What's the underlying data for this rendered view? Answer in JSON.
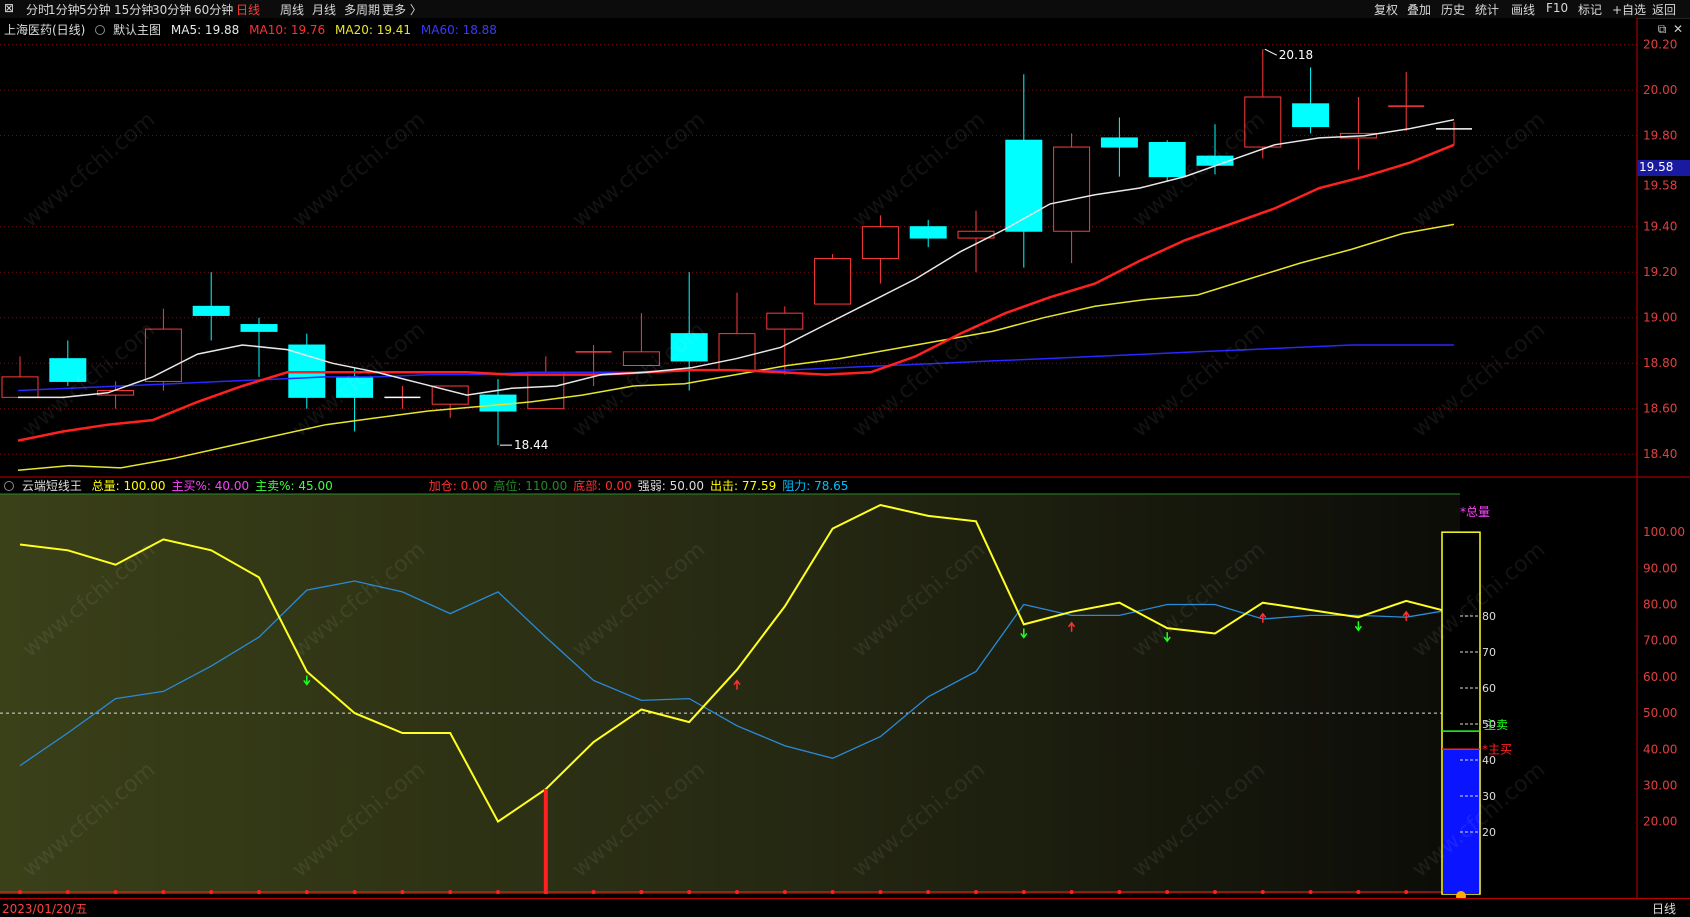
{
  "toolbar": {
    "left_items": [
      "分时",
      "1分钟",
      "5分钟",
      "15分钟",
      "30分钟",
      "60分钟",
      "日线",
      "周线",
      "月线",
      "多周期",
      "更多 〉"
    ],
    "active_item": "日线",
    "right_items": [
      "复权",
      "叠加",
      "历史",
      "统计",
      "画线",
      "F10",
      "标记",
      "+自选",
      "返回"
    ]
  },
  "main_panel": {
    "stock": "上海医药(日线)",
    "chart_name": "默认主图",
    "ma5_label": "MA5: 19.88",
    "ma10_label": "MA10: 19.76",
    "ma20_label": "MA20: 19.41",
    "ma60_label": "MA60: 18.88",
    "high_marker": "20.18",
    "low_marker": "18.44",
    "current_price_tag": "19.58",
    "colors": {
      "ma5": "#e8e8e8",
      "ma10": "#ff2020",
      "ma20": "#e6e62c",
      "ma60": "#2828ff",
      "up": "#ff3b3b",
      "down": "#00ffff"
    }
  },
  "sub_panel": {
    "indicator": "云端短线王",
    "labels": [
      {
        "text": "总量: 100.00",
        "color": "#ffff00"
      },
      {
        "text": "主买%: 40.00",
        "color": "#ff40ff"
      },
      {
        "text": "主卖%: 45.00",
        "color": "#40ff40"
      },
      {
        "text": "加仓: 0.00",
        "color": "#ff3030"
      },
      {
        "text": "高位: 110.00",
        "color": "#228b22"
      },
      {
        "text": "底部: 0.00",
        "color": "#ff3030"
      },
      {
        "text": "强弱: 50.00",
        "color": "#dddddd"
      },
      {
        "text": "出击: 77.59",
        "color": "#ffff00"
      },
      {
        "text": "阻力: 78.65",
        "color": "#00bfff"
      }
    ],
    "gauge_labels": {
      "total": "*总量",
      "sell": "主卖",
      "buy": "*主买"
    },
    "gauge_ticks": [
      "80",
      "70",
      "60",
      "50",
      "40",
      "30",
      "20"
    ]
  },
  "bottom": {
    "date": "2023/01/20/五",
    "period": "日线"
  },
  "watermark": "www.cfchi.com",
  "chart_data": [
    {
      "type": "candlestick",
      "y_ticks": [
        "20.20",
        "20.00",
        "19.80",
        "19.58",
        "19.40",
        "19.20",
        "19.00",
        "18.80",
        "18.60",
        "18.40"
      ],
      "ylim": [
        18.3,
        20.26
      ],
      "candles": [
        {
          "o": 18.65,
          "c": 18.74,
          "h": 18.83,
          "l": 18.65
        },
        {
          "o": 18.82,
          "c": 18.72,
          "h": 18.9,
          "l": 18.7
        },
        {
          "o": 18.66,
          "c": 18.68,
          "h": 18.72,
          "l": 18.6
        },
        {
          "o": 18.72,
          "c": 18.95,
          "h": 19.04,
          "l": 18.68
        },
        {
          "o": 19.05,
          "c": 19.01,
          "h": 19.2,
          "l": 18.9
        },
        {
          "o": 18.97,
          "c": 18.94,
          "h": 19.0,
          "l": 18.74
        },
        {
          "o": 18.88,
          "c": 18.65,
          "h": 18.93,
          "l": 18.6
        },
        {
          "o": 18.74,
          "c": 18.65,
          "h": 18.78,
          "l": 18.5
        },
        {
          "o": 18.65,
          "c": 18.65,
          "h": 18.7,
          "l": 18.6
        },
        {
          "o": 18.62,
          "c": 18.7,
          "h": 18.7,
          "l": 18.56
        },
        {
          "o": 18.66,
          "c": 18.59,
          "h": 18.73,
          "l": 18.44
        },
        {
          "o": 18.6,
          "c": 18.76,
          "h": 18.83,
          "l": 18.6
        },
        {
          "o": 18.85,
          "c": 18.85,
          "h": 18.88,
          "l": 18.7
        },
        {
          "o": 18.79,
          "c": 18.85,
          "h": 19.02,
          "l": 18.79
        },
        {
          "o": 18.93,
          "c": 18.81,
          "h": 19.2,
          "l": 18.68
        },
        {
          "o": 18.77,
          "c": 18.93,
          "h": 19.11,
          "l": 18.77
        },
        {
          "o": 18.95,
          "c": 19.02,
          "h": 19.05,
          "l": 18.75
        },
        {
          "o": 19.06,
          "c": 19.26,
          "h": 19.28,
          "l": 19.06
        },
        {
          "o": 19.26,
          "c": 19.4,
          "h": 19.45,
          "l": 19.15
        },
        {
          "o": 19.4,
          "c": 19.35,
          "h": 19.43,
          "l": 19.31
        },
        {
          "o": 19.35,
          "c": 19.38,
          "h": 19.47,
          "l": 19.2
        },
        {
          "o": 19.78,
          "c": 19.38,
          "h": 20.07,
          "l": 19.22
        },
        {
          "o": 19.38,
          "c": 19.75,
          "h": 19.81,
          "l": 19.24
        },
        {
          "o": 19.79,
          "c": 19.75,
          "h": 19.88,
          "l": 19.62
        },
        {
          "o": 19.77,
          "c": 19.62,
          "h": 19.78,
          "l": 19.6
        },
        {
          "o": 19.71,
          "c": 19.67,
          "h": 19.85,
          "l": 19.63
        },
        {
          "o": 19.75,
          "c": 19.97,
          "h": 20.18,
          "l": 19.7
        },
        {
          "o": 19.94,
          "c": 19.84,
          "h": 20.1,
          "l": 19.81
        },
        {
          "o": 19.79,
          "c": 19.81,
          "h": 19.97,
          "l": 19.65
        },
        {
          "o": 19.93,
          "c": 19.93,
          "h": 20.08,
          "l": 19.82
        },
        {
          "o": 19.83,
          "c": 19.83,
          "h": 19.86,
          "l": 19.76
        }
      ],
      "ma5": [
        18.65,
        18.65,
        18.67,
        18.74,
        18.84,
        18.88,
        18.86,
        18.8,
        18.76,
        18.71,
        18.66,
        18.69,
        18.7,
        18.75,
        18.76,
        18.78,
        18.82,
        18.87,
        18.97,
        19.07,
        19.17,
        19.29,
        19.39,
        19.5,
        19.54,
        19.57,
        19.62,
        19.69,
        19.76,
        19.79,
        19.8,
        19.83,
        19.87
      ],
      "ma10": [
        18.46,
        18.5,
        18.53,
        18.55,
        18.63,
        18.7,
        18.76,
        18.76,
        18.76,
        18.76,
        18.76,
        18.75,
        18.75,
        18.75,
        18.76,
        18.77,
        18.77,
        18.76,
        18.75,
        18.76,
        18.83,
        18.93,
        19.02,
        19.09,
        19.15,
        19.25,
        19.34,
        19.41,
        19.48,
        19.57,
        19.62,
        19.68,
        19.76
      ],
      "ma20": [
        18.33,
        18.35,
        18.34,
        18.38,
        18.43,
        18.48,
        18.53,
        18.56,
        18.59,
        18.61,
        18.63,
        18.66,
        18.7,
        18.71,
        18.75,
        18.79,
        18.82,
        18.86,
        18.9,
        18.94,
        19.0,
        19.05,
        19.08,
        19.1,
        19.17,
        19.24,
        19.3,
        19.37,
        19.41
      ],
      "ma60": [
        18.68,
        18.69,
        18.7,
        18.71,
        18.72,
        18.73,
        18.74,
        18.74,
        18.75,
        18.75,
        18.76,
        18.76,
        18.76,
        18.77,
        18.77,
        18.77,
        18.78,
        18.79,
        18.8,
        18.81,
        18.82,
        18.83,
        18.84,
        18.85,
        18.86,
        18.87,
        18.88,
        18.88,
        18.88
      ]
    },
    {
      "type": "line",
      "y_ticks": [
        "100.00",
        "90.00",
        "80.00",
        "70.00",
        "60.00",
        "50.00",
        "40.00",
        "30.00",
        "20.00"
      ],
      "ylim": [
        0,
        110
      ],
      "series": [
        {
          "values": [
            96.6,
            95,
            91,
            98,
            95,
            87.5,
            61.5,
            50,
            44.5,
            44.5,
            20,
            29,
            42,
            51,
            47.5,
            62,
            79.5,
            101,
            107.5,
            104.5,
            103,
            74.5,
            78,
            80.5,
            73.5,
            72,
            80.5,
            78.5,
            76.5,
            81,
            77.6
          ]
        },
        {
          "values": [
            35.5,
            44.5,
            54,
            56,
            63,
            71,
            84,
            86.5,
            83.5,
            77.5,
            83.5,
            71,
            59,
            53.5,
            54,
            46.5,
            41,
            37.5,
            43.5,
            54.5,
            61.5,
            80,
            77,
            77,
            80,
            80,
            76,
            77,
            77,
            76.5,
            78.7
          ]
        }
      ],
      "gauge": {
        "total": 100,
        "buy": 40,
        "sell": 45
      }
    }
  ]
}
